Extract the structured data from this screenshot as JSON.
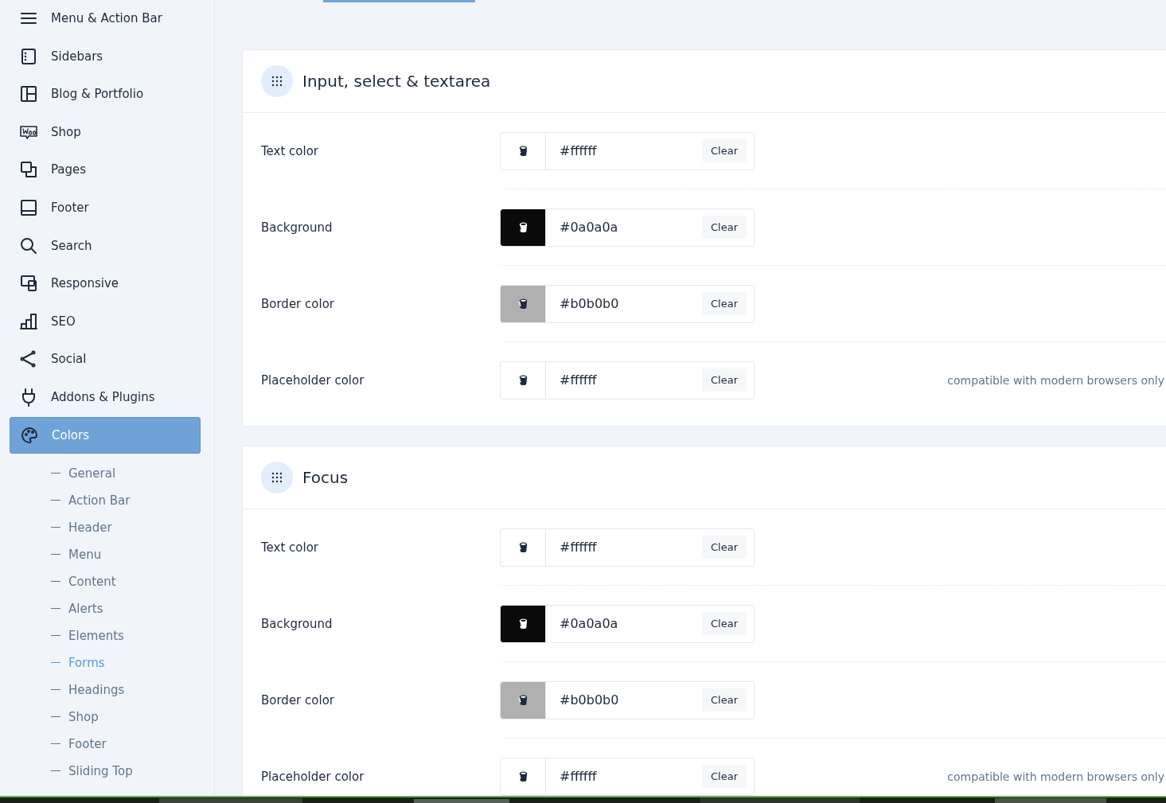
{
  "sidebar": {
    "items": [
      {
        "label": "Menu & Action Bar",
        "selected": false
      },
      {
        "label": "Sidebars",
        "selected": false
      },
      {
        "label": "Blog & Portfolio",
        "selected": false
      },
      {
        "label": "Shop",
        "selected": false
      },
      {
        "label": "Pages",
        "selected": false
      },
      {
        "label": "Footer",
        "selected": false
      },
      {
        "label": "Search",
        "selected": false
      },
      {
        "label": "Responsive",
        "selected": false
      },
      {
        "label": "SEO",
        "selected": false
      },
      {
        "label": "Social",
        "selected": false
      },
      {
        "label": "Addons & Plugins",
        "selected": false
      },
      {
        "label": "Colors",
        "selected": true
      }
    ],
    "sub_items": [
      {
        "label": "General",
        "selected": false
      },
      {
        "label": "Action Bar",
        "selected": false
      },
      {
        "label": "Header",
        "selected": false
      },
      {
        "label": "Menu",
        "selected": false
      },
      {
        "label": "Content",
        "selected": false
      },
      {
        "label": "Alerts",
        "selected": false
      },
      {
        "label": "Elements",
        "selected": false
      },
      {
        "label": "Forms",
        "selected": true
      },
      {
        "label": "Headings",
        "selected": false
      },
      {
        "label": "Shop",
        "selected": false
      },
      {
        "label": "Footer",
        "selected": false
      },
      {
        "label": "Sliding Top",
        "selected": false
      }
    ]
  },
  "sections": [
    {
      "title": "Input, select & textarea",
      "rows": [
        {
          "label": "Text color",
          "value": "#ffffff",
          "color": "#ffffff",
          "clear": "Clear"
        },
        {
          "label": "Background",
          "value": "#0a0a0a",
          "color": "#0a0a0a",
          "clear": "Clear"
        },
        {
          "label": "Border color",
          "value": "#b0b0b0",
          "color": "#b0b0b0",
          "clear": "Clear"
        },
        {
          "label": "Placeholder color",
          "value": "#ffffff",
          "color": "#ffffff",
          "clear": "Clear",
          "note": "compatible with modern browsers only"
        }
      ]
    },
    {
      "title": "Focus",
      "rows": [
        {
          "label": "Text color",
          "value": "#ffffff",
          "color": "#ffffff",
          "clear": "Clear"
        },
        {
          "label": "Background",
          "value": "#0a0a0a",
          "color": "#0a0a0a",
          "clear": "Clear"
        },
        {
          "label": "Border color",
          "value": "#b0b0b0",
          "color": "#b0b0b0",
          "clear": "Clear"
        },
        {
          "label": "Placeholder color",
          "value": "#ffffff",
          "color": "#ffffff",
          "clear": "Clear",
          "note": "compatible with modern browsers only"
        }
      ]
    }
  ]
}
